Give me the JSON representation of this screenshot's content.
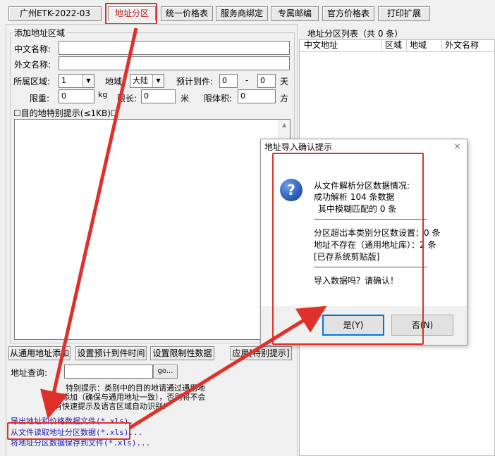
{
  "tabs": [
    {
      "label": "广州ETK-2022-03"
    },
    {
      "label": "地址分区"
    },
    {
      "label": "统一价格表"
    },
    {
      "label": "服务商绑定"
    },
    {
      "label": "专属邮编"
    },
    {
      "label": "官方价格表"
    },
    {
      "label": "打印扩展"
    }
  ],
  "add_section": {
    "legend": "添加地址区域",
    "cn_name_label": "中文名称:",
    "en_name_label": "外文名称:",
    "zone_label": "所属区域:",
    "zone_value": "1",
    "region_label": "地域:",
    "region_value": "大陆",
    "eta_label": "预计到件:",
    "eta_from": "0",
    "eta_dash": "-",
    "eta_to": "0",
    "eta_unit": "天",
    "weight_label": "限重:",
    "weight_value": "0",
    "weight_unit": "kg",
    "length_label": "限长:",
    "length_value": "0",
    "length_unit": "米",
    "volume_label": "限体积:",
    "volume_value": "0",
    "volume_unit": "方",
    "special_tip_label": "☐目的地特别提示(≤1KB)☐"
  },
  "buttons": {
    "from_common": "从通用地址添加",
    "set_eta": "设置预计到件时间",
    "set_limits": "设置限制性数据",
    "apply_special": "应用[特别提示]"
  },
  "query": {
    "label": "地址查询:",
    "go": "go..."
  },
  "notice": {
    "line1": "特别提示：类别中的目的地请通过通用地",
    "line2": "址添加（确保与通用地址一致），否则将不会",
    "line3": "有快速提示及语言区域自动识别!"
  },
  "links": {
    "export": "导出地址和价格数据文件(*.xls)...",
    "read_file": "从文件读取地址分区数据(*.xls)...",
    "save_file": "将地址分区数据保存到文件(*.xls)..."
  },
  "list": {
    "title": "地址分区列表（共 0 条）",
    "columns": [
      "中文地址",
      "区域",
      "地域",
      "外文名称"
    ]
  },
  "dialog": {
    "title": "地址导入确认提示",
    "close": "×",
    "line1": "从文件解析分区数据情况:",
    "line2": "成功解析 104 条数据",
    "line3": "其中模糊匹配的 0 条",
    "line4": "分区超出本类别分区数设置：0 条",
    "line5": "地址不存在（通用地址库）：2 条",
    "line6": "[已存系统剪贴版]",
    "line7": "导入数据吗？请确认！",
    "yes": "是(Y)",
    "no": "否(N)",
    "icon_glyph": "?"
  },
  "colors": {
    "annotation_red": "#e0302a",
    "link_blue": "#1a1ab4",
    "question_icon": "#2a5fb8"
  }
}
